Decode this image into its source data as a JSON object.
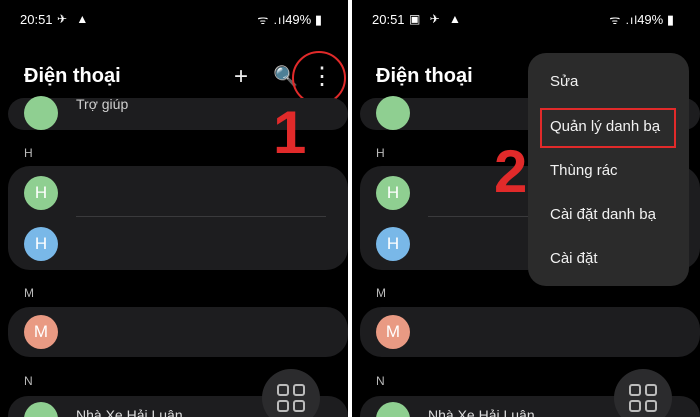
{
  "status_bar": {
    "left": {
      "time": "20:51",
      "icons": "✈ ▲"
    },
    "right": {
      "time": "20:51",
      "icons": "▣ ✈ ▲"
    },
    "signal": "ᯤ .ıl",
    "battery": "49% ▮"
  },
  "header": {
    "title": "Điện thoại",
    "plus": "+",
    "search": "🔍",
    "more": "⋮"
  },
  "sections": {
    "h": "H",
    "m": "M",
    "n": "N"
  },
  "contacts": {
    "h1": "H",
    "h2": "H",
    "m1": "M",
    "partial_top": "Trợ giúp",
    "bottom_name": "Nhà Xe Hải Luân"
  },
  "steps": {
    "one": "1",
    "two": "2"
  },
  "menu": {
    "items": [
      "Sửa",
      "Quản lý danh bạ",
      "Thùng rác",
      "Cài đặt danh bạ",
      "Cài đặt"
    ]
  },
  "colors": {
    "highlight_red": "#e12a2a",
    "avatar_green": "#8fcf91",
    "avatar_blue": "#79b8e8",
    "avatar_salmon": "#e99a83"
  }
}
